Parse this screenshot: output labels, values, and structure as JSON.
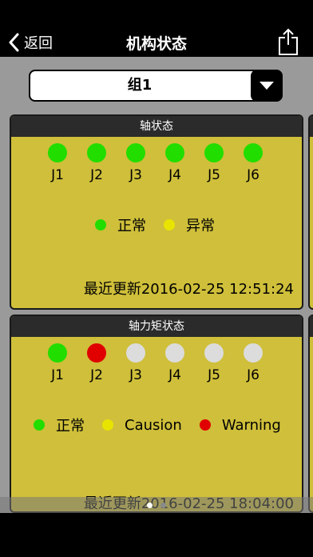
{
  "navbar": {
    "back_label": "返回",
    "title": "机构状态"
  },
  "selector": {
    "selected": "组1"
  },
  "axis_card": {
    "title": "轴状态",
    "joints": [
      {
        "label": "J1",
        "status": "normal"
      },
      {
        "label": "J2",
        "status": "normal"
      },
      {
        "label": "J3",
        "status": "normal"
      },
      {
        "label": "J4",
        "status": "normal"
      },
      {
        "label": "J5",
        "status": "normal"
      },
      {
        "label": "J6",
        "status": "normal"
      }
    ],
    "legend": [
      {
        "label": "正常",
        "color": "#22dd00"
      },
      {
        "label": "异常",
        "color": "#e8e400"
      }
    ],
    "updated": "最近更新2016-02-25 12:51:24"
  },
  "torque_card": {
    "title": "轴力矩状态",
    "joints": [
      {
        "label": "J1",
        "status": "normal"
      },
      {
        "label": "J2",
        "status": "warning"
      },
      {
        "label": "J3",
        "status": "none"
      },
      {
        "label": "J4",
        "status": "none"
      },
      {
        "label": "J5",
        "status": "none"
      },
      {
        "label": "J6",
        "status": "none"
      }
    ],
    "legend": [
      {
        "label": "正常",
        "color": "#22dd00"
      },
      {
        "label": "Causion",
        "color": "#e8e400"
      },
      {
        "label": "Warning",
        "color": "#e00000"
      }
    ],
    "updated": "最近更新2016-02-25 18:04:00"
  },
  "colors": {
    "normal": "#22dd00",
    "caution": "#e8e400",
    "warning": "#e00000",
    "none": "#dcdcdc",
    "card": "#cfbf3a"
  },
  "pager": {
    "pages": 2,
    "current": 1
  }
}
